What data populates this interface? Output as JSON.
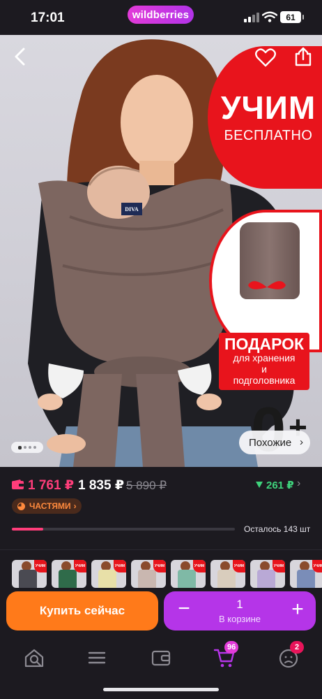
{
  "status_bar": {
    "time": "17:01",
    "battery": "61"
  },
  "brand": "wildberries",
  "hero": {
    "promo_big": "УЧИМ",
    "promo_small": "БЕСПЛАТНО",
    "gift_title": "ПОДАРОК",
    "gift_sub_1": "для хранения",
    "gift_sub_2": "и",
    "gift_sub_3": "подголовника",
    "product_tag": "DIVA",
    "age_badge": "0",
    "age_plus": "+",
    "similar_label": "Похожие",
    "similar_chevron": "›",
    "gallery_dots": 4,
    "gallery_active_index": 0
  },
  "price": {
    "wallet_price": "1 761 ₽",
    "price": "1 835 ₽",
    "old_price": "5 890 ₽",
    "cashback": "261 ₽",
    "installments_label": "ЧАСТЯМИ",
    "installments_chevron": "›",
    "stock_text": "Осталось 143 шт",
    "stock_fraction": 0.14,
    "colors": {
      "wallet": "#ff3d7a",
      "cashback": "#3fd37c",
      "installments": "#ff8a3d"
    }
  },
  "variants": {
    "badge": "УЧИМ",
    "items": [
      {
        "color": "#4a4a52"
      },
      {
        "color": "#2f6b4a"
      },
      {
        "color": "#e8e0a8"
      },
      {
        "color": "#c9b7b0"
      },
      {
        "color": "#7fb9a6"
      },
      {
        "color": "#d9cdbd"
      },
      {
        "color": "#b9a9d6"
      },
      {
        "color": "#7a8db8"
      }
    ]
  },
  "actions": {
    "buy_label": "Купить сейчас",
    "minus_label": "−",
    "plus_label": "+",
    "quantity": "1",
    "in_cart_label": "В корзине",
    "colors": {
      "buy": "#ff7a1a",
      "cart": "#b535e8"
    }
  },
  "bottom_nav": {
    "items": [
      {
        "name": "home",
        "icon": "home-search-icon"
      },
      {
        "name": "catalog",
        "icon": "menu-icon"
      },
      {
        "name": "wallet",
        "icon": "wallet-icon"
      },
      {
        "name": "cart",
        "icon": "cart-icon",
        "badge": "96"
      },
      {
        "name": "profile",
        "icon": "profile-icon",
        "badge": "2"
      }
    ]
  }
}
